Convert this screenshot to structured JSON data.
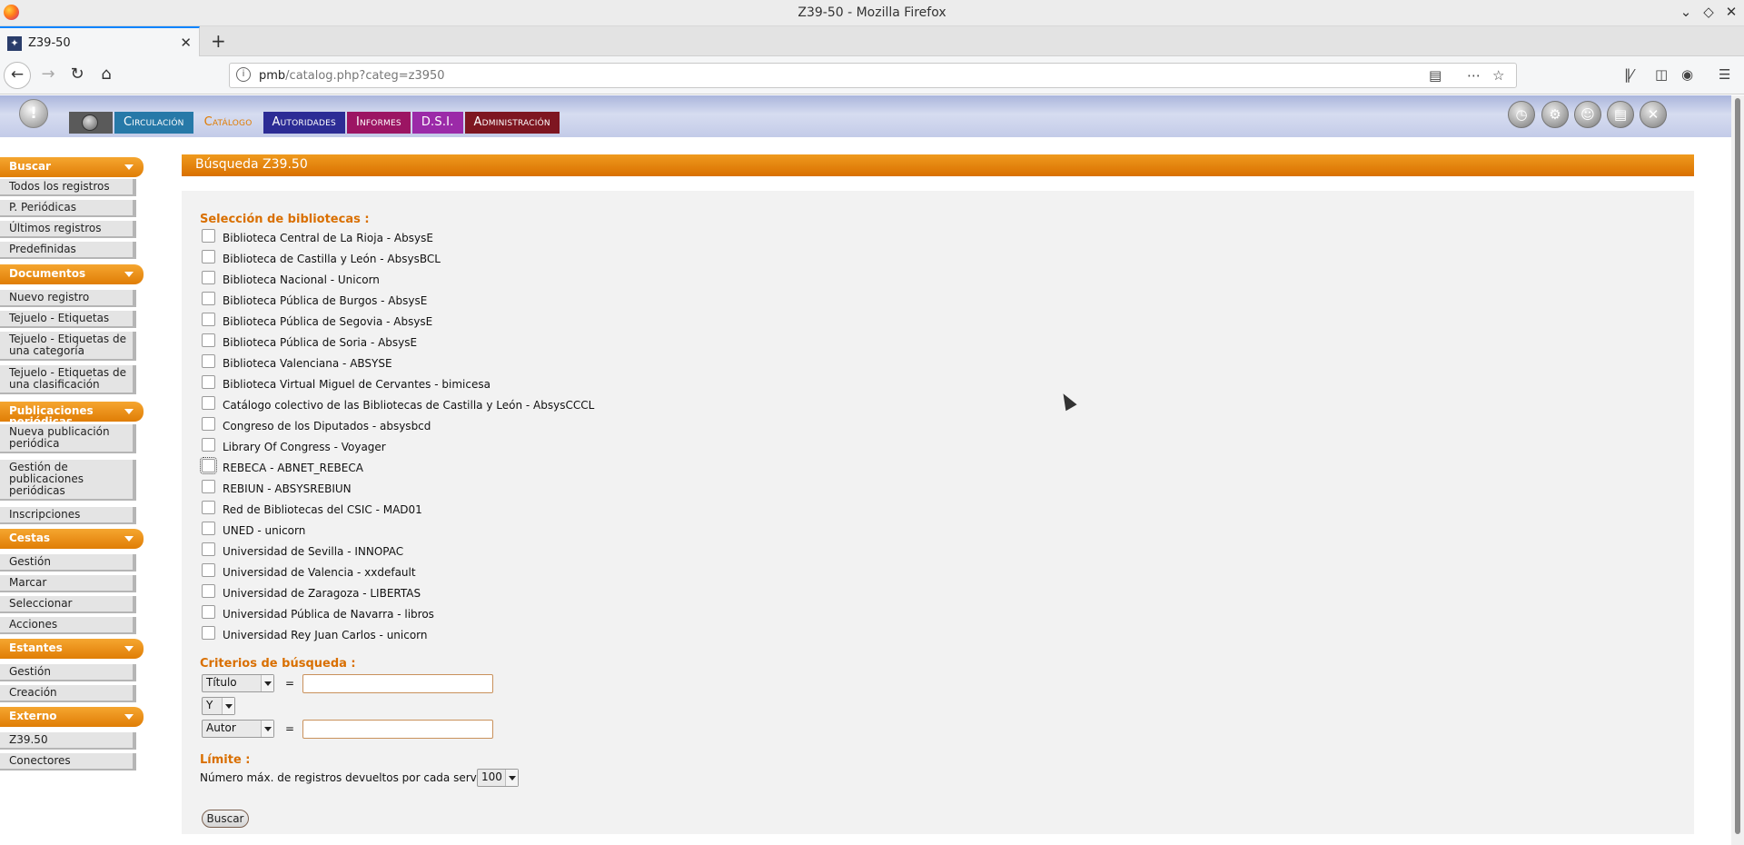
{
  "window": {
    "title": "Z39-50 - Mozilla Firefox"
  },
  "browser": {
    "tab_title": "Z39-50",
    "url_host": "pmb",
    "url_path": "/catalog.php?categ=z3950"
  },
  "menu": {
    "items": [
      "Circulación",
      "Catálogo",
      "Autoridades",
      "Informes",
      "D.S.I.",
      "Administración"
    ]
  },
  "sidebar": {
    "sections": [
      {
        "title": "Buscar",
        "items": [
          "Todos los registros",
          "P. Periódicas",
          "Últimos registros",
          "Predefinidas"
        ]
      },
      {
        "title": "Documentos",
        "items": [
          "Nuevo registro",
          "Tejuelo - Etiquetas",
          "Tejuelo - Etiquetas de una categoría",
          "Tejuelo - Etiquetas de una clasificación"
        ]
      },
      {
        "title": "Publicaciones periódicas",
        "items": [
          "Nueva publicación periódica",
          "Gestión de publicaciones periódicas",
          "Inscripciones"
        ]
      },
      {
        "title": "Cestas",
        "items": [
          "Gestión",
          "Marcar",
          "Seleccionar",
          "Acciones"
        ]
      },
      {
        "title": "Estantes",
        "items": [
          "Gestión",
          "Creación"
        ]
      },
      {
        "title": "Externo",
        "items": [
          "Z39.50",
          "Conectores"
        ]
      }
    ]
  },
  "main": {
    "page_title": "Búsqueda Z39.50",
    "libraries_label": "Selección de bibliotecas :",
    "libraries": [
      "Biblioteca Central de La Rioja - AbsysE",
      "Biblioteca de Castilla y León - AbsysBCL",
      "Biblioteca Nacional - Unicorn",
      "Biblioteca Pública de Burgos - AbsysE",
      "Biblioteca Pública de Segovia - AbsysE",
      "Biblioteca Pública de Soria - AbsysE",
      "Biblioteca Valenciana - ABSYSE",
      "Biblioteca Virtual Miguel de Cervantes - bimicesa",
      "Catálogo colectivo de las Bibliotecas de Castilla y León - AbsysCCCL",
      "Congreso de los Diputados - absysbcd",
      "Library Of Congress - Voyager",
      "REBECA - ABNET_REBECA",
      "REBIUN - ABSYSREBIUN",
      "Red de Bibliotecas del CSIC - MAD01",
      "UNED - unicorn",
      "Universidad de Sevilla - INNOPAC",
      "Universidad de Valencia - xxdefault",
      "Universidad de Zaragoza - LIBERTAS",
      "Universidad Pública de Navarra - libros",
      "Universidad Rey Juan Carlos - unicorn"
    ],
    "criteria_label": "Criterios de búsqueda :",
    "criteria": {
      "field1": "Título",
      "operator": "Y",
      "field2": "Autor",
      "equals": "=",
      "value1": "",
      "value2": ""
    },
    "limit_label": "Límite :",
    "limit_text": "Número máx. de registros devueltos por cada servidor :",
    "limit_value": "100",
    "search_button": "Buscar"
  }
}
